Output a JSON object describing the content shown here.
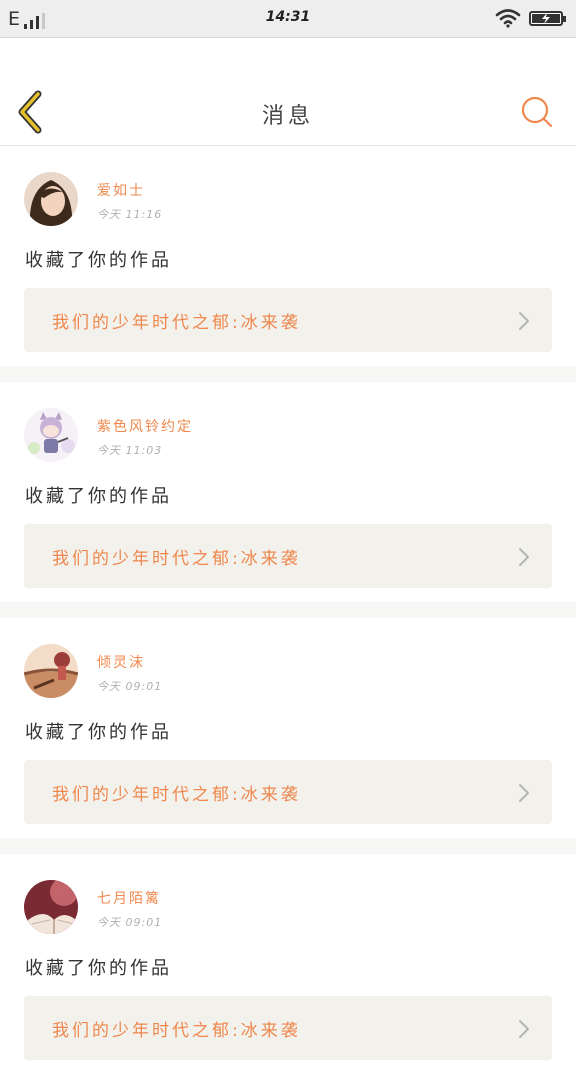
{
  "status_bar": {
    "network": "E",
    "time": "14:31"
  },
  "nav": {
    "title": "消息"
  },
  "colors": {
    "accent": "#f0884e",
    "back_arrow": "#e6c22a",
    "card_link_bg": "#f2f1ec"
  },
  "icons": {
    "back": "back-arrow-icon",
    "search": "search-icon",
    "chevron": "chevron-right-icon"
  },
  "messages": [
    {
      "user": "爱如士",
      "time": "今天 11:16",
      "action": "收藏了你的作品",
      "work_title": "我们的少年时代之郁:冰来袭"
    },
    {
      "user": "紫色风铃约定",
      "time": "今天 11:03",
      "action": "收藏了你的作品",
      "work_title": "我们的少年时代之郁:冰来袭"
    },
    {
      "user": "倾灵沫",
      "time": "今天 09:01",
      "action": "收藏了你的作品",
      "work_title": "我们的少年时代之郁:冰来袭"
    },
    {
      "user": "七月陌篱",
      "time": "今天 09:01",
      "action": "收藏了你的作品",
      "work_title": "我们的少年时代之郁:冰来袭"
    }
  ]
}
